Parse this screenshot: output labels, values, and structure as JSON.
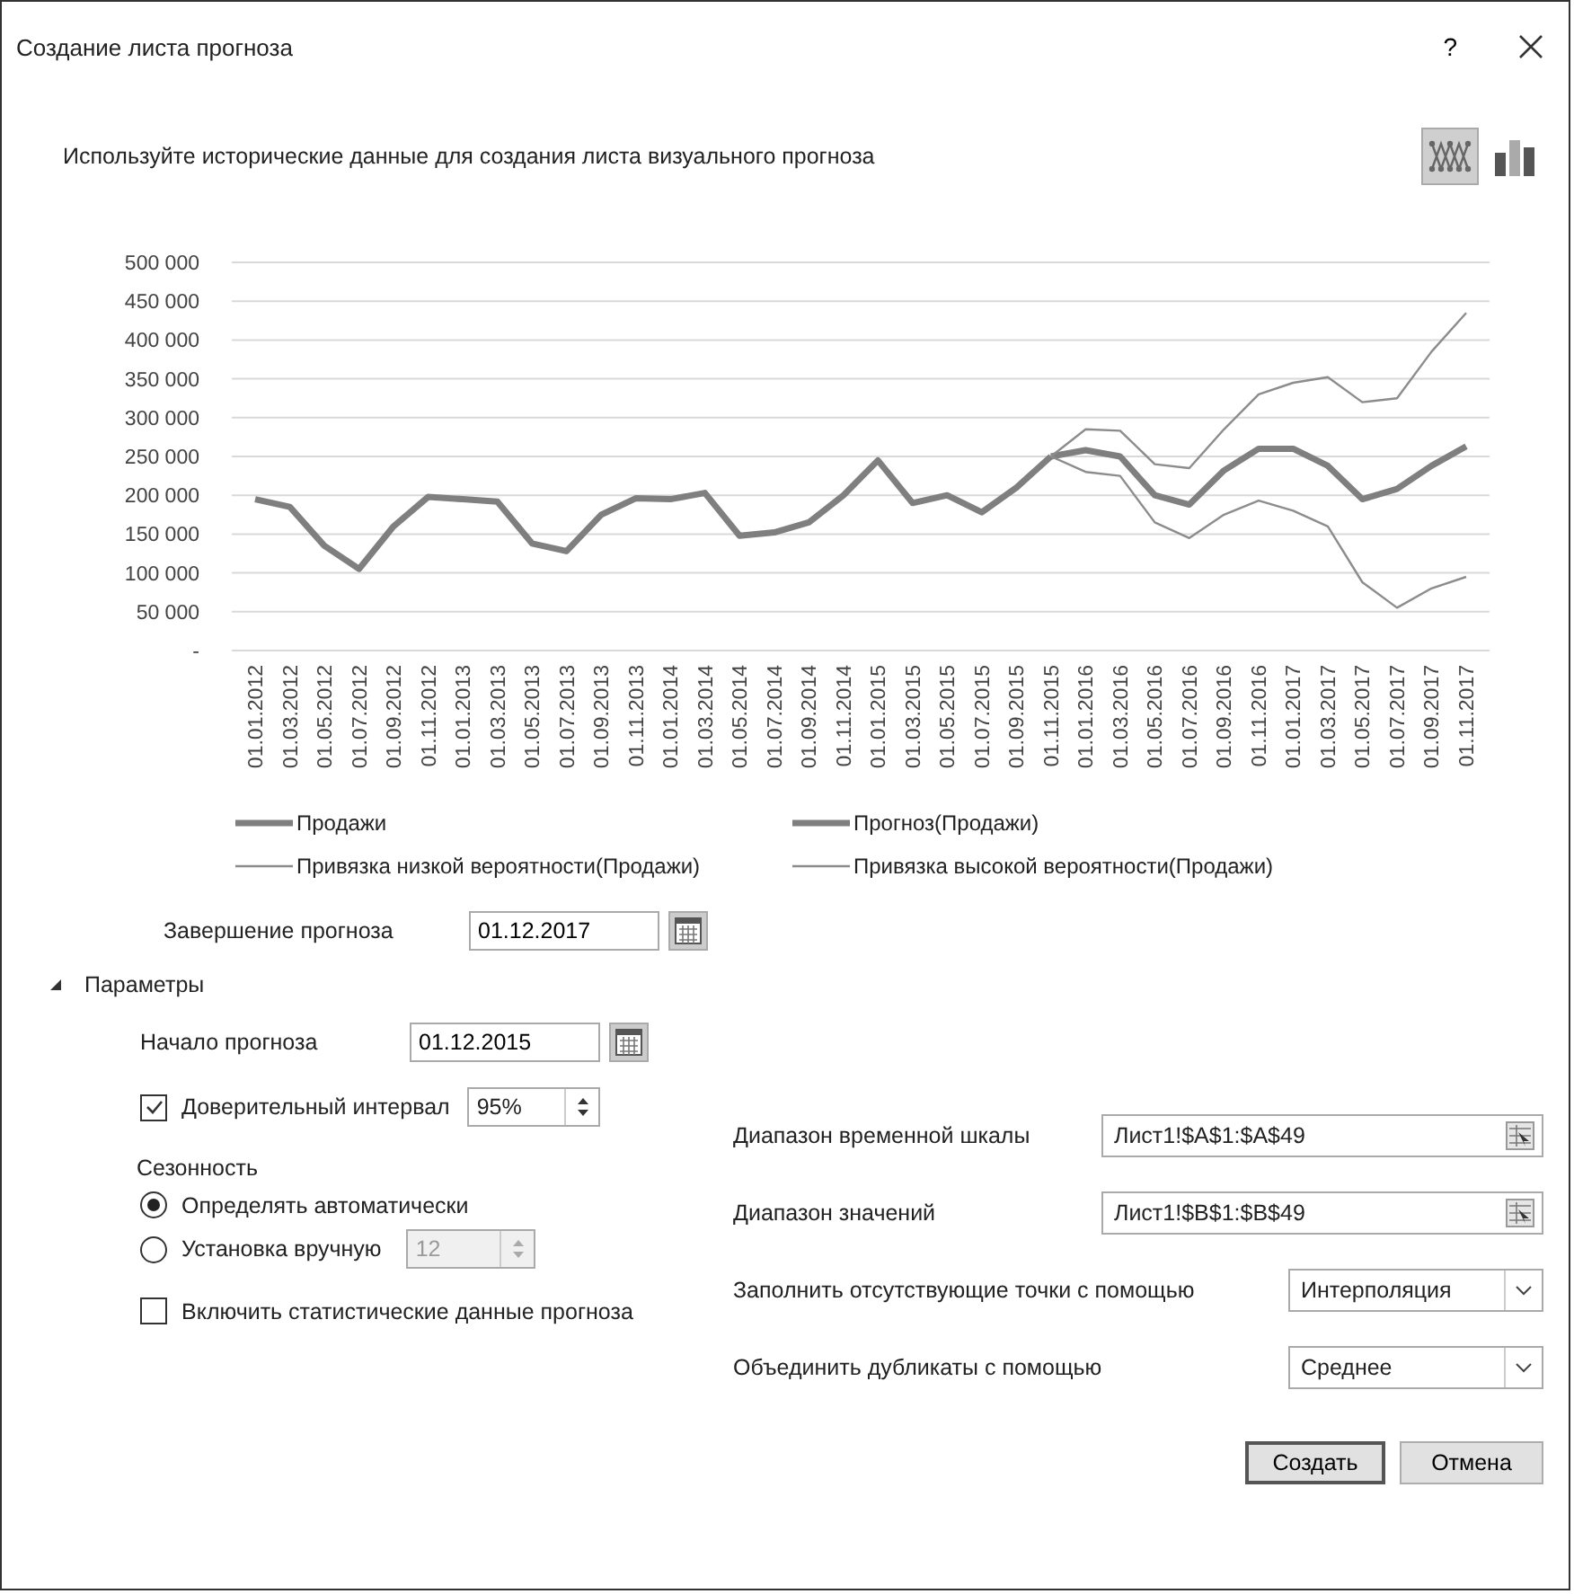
{
  "window": {
    "title": "Создание листа прогноза",
    "help": "?"
  },
  "subtitle": "Используйте исторические данные для создания листа визуального прогноза",
  "chart_types": [
    {
      "kind": "line",
      "selected": true
    },
    {
      "kind": "bar",
      "selected": false
    }
  ],
  "chart": {
    "series_styles": [
      {
        "kind": "thick"
      },
      {
        "kind": "thick"
      },
      {
        "kind": "thin"
      },
      {
        "kind": "thin"
      }
    ],
    "chart_data": {
      "type": "line",
      "grid": true,
      "legend": true,
      "categories": [
        "01.01.2012",
        "01.03.2012",
        "01.05.2012",
        "01.07.2012",
        "01.09.2012",
        "01.11.2012",
        "01.01.2013",
        "01.03.2013",
        "01.05.2013",
        "01.07.2013",
        "01.09.2013",
        "01.11.2013",
        "01.01.2014",
        "01.03.2014",
        "01.05.2014",
        "01.07.2014",
        "01.09.2014",
        "01.11.2014",
        "01.01.2015",
        "01.03.2015",
        "01.05.2015",
        "01.07.2015",
        "01.09.2015",
        "01.11.2015",
        "01.01.2016",
        "01.03.2016",
        "01.05.2016",
        "01.07.2016",
        "01.09.2016",
        "01.11.2016",
        "01.01.2017",
        "01.03.2017",
        "01.05.2017",
        "01.07.2017",
        "01.09.2017",
        "01.11.2017"
      ],
      "ylim": [
        0,
        500000
      ],
      "yticks": [
        {
          "value": 0,
          "label": "-"
        },
        {
          "value": 50000,
          "label": "50 000"
        },
        {
          "value": 100000,
          "label": "100 000"
        },
        {
          "value": 150000,
          "label": "150 000"
        },
        {
          "value": 200000,
          "label": "200 000"
        },
        {
          "value": 250000,
          "label": "250 000"
        },
        {
          "value": 300000,
          "label": "300 000"
        },
        {
          "value": 350000,
          "label": "350 000"
        },
        {
          "value": 400000,
          "label": "400 000"
        },
        {
          "value": 450000,
          "label": "450 000"
        },
        {
          "value": 500000,
          "label": "500 000"
        }
      ],
      "series": [
        {
          "name": "Продажи",
          "color": "#7f7f7f",
          "values": [
            195000,
            185000,
            135000,
            105000,
            160000,
            198000,
            195000,
            192000,
            138000,
            128000,
            175000,
            196000,
            195000,
            203000,
            148000,
            152000,
            165000,
            200000,
            245000,
            190000,
            200000,
            178000,
            210000,
            250000,
            null,
            null,
            null,
            null,
            null,
            null,
            null,
            null,
            null,
            null,
            null,
            null
          ]
        },
        {
          "name": "Прогноз(Продажи)",
          "color": "#7f7f7f",
          "values": [
            null,
            null,
            null,
            null,
            null,
            null,
            null,
            null,
            null,
            null,
            null,
            null,
            null,
            null,
            null,
            null,
            null,
            null,
            null,
            null,
            null,
            null,
            null,
            250000,
            258000,
            250000,
            200000,
            188000,
            232000,
            260000,
            260000,
            238000,
            195000,
            208000,
            238000,
            263000
          ]
        },
        {
          "name": "Привязка низкой вероятности(Продажи)",
          "color": "#8c8c8c",
          "values": [
            null,
            null,
            null,
            null,
            null,
            null,
            null,
            null,
            null,
            null,
            null,
            null,
            null,
            null,
            null,
            null,
            null,
            null,
            null,
            null,
            null,
            null,
            null,
            250000,
            230000,
            225000,
            165000,
            145000,
            175000,
            193000,
            180000,
            160000,
            88000,
            55000,
            80000,
            95000
          ]
        },
        {
          "name": "Привязка высокой вероятности(Продажи)",
          "color": "#8c8c8c",
          "values": [
            null,
            null,
            null,
            null,
            null,
            null,
            null,
            null,
            null,
            null,
            null,
            null,
            null,
            null,
            null,
            null,
            null,
            null,
            null,
            null,
            null,
            null,
            null,
            250000,
            285000,
            283000,
            240000,
            235000,
            285000,
            330000,
            345000,
            352000,
            320000,
            325000,
            385000,
            435000
          ]
        }
      ]
    }
  },
  "forecast_end": {
    "label": "Завершение прогноза",
    "value": "01.12.2017"
  },
  "parameters": {
    "label": "Параметры",
    "expanded": true
  },
  "forecast_start": {
    "label": "Начало прогноза",
    "value": "01.12.2015"
  },
  "confidence": {
    "label": "Доверительный интервал",
    "checked": true,
    "value": "95%"
  },
  "seasonality": {
    "label": "Сезонность",
    "options": [
      {
        "label": "Определять автоматически",
        "selected": true
      },
      {
        "label": "Установка вручную",
        "selected": false,
        "value": "12",
        "disabled": true
      }
    ]
  },
  "include_stats": {
    "label": "Включить статистические данные прогноза",
    "checked": false
  },
  "ranges": [
    {
      "kind": "range",
      "label": "Диапазон временной шкалы",
      "value": "Лист1!$A$1:$A$49"
    },
    {
      "kind": "range",
      "label": "Диапазон значений",
      "value": "Лист1!$B$1:$B$49"
    },
    {
      "kind": "dropdown",
      "label": "Заполнить отсутствующие точки с помощью",
      "value": "Интерполяция"
    },
    {
      "kind": "dropdown",
      "label": "Объединить дубликаты с помощью",
      "value": "Среднее"
    }
  ],
  "buttons": [
    {
      "label": "Создать",
      "default": true
    },
    {
      "label": "Отмена",
      "default": false
    }
  ]
}
